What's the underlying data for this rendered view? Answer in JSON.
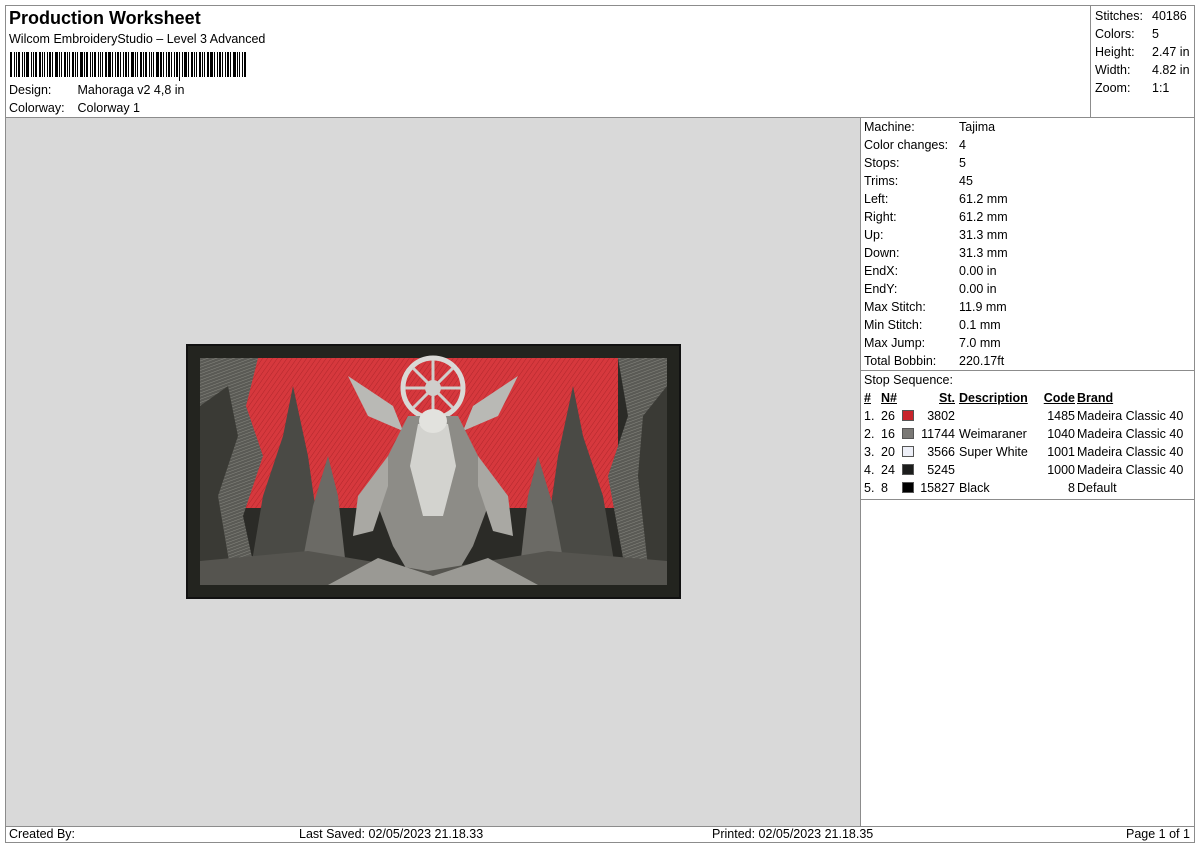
{
  "header": {
    "title": "Production Worksheet",
    "subtitle": "Wilcom EmbroideryStudio – Level 3 Advanced",
    "design_label": "Design:",
    "design_value": "Mahoraga v2 4,8 in",
    "colorway_label": "Colorway:",
    "colorway_value": "Colorway 1"
  },
  "stats": [
    {
      "label": "Stitches:",
      "value": "40186"
    },
    {
      "label": "Colors:",
      "value": "5"
    },
    {
      "label": "Height:",
      "value": "2.47 in"
    },
    {
      "label": "Width:",
      "value": "4.82 in"
    },
    {
      "label": "Zoom:",
      "value": "1:1"
    }
  ],
  "machine_info": [
    {
      "label": "Machine:",
      "value": "Tajima"
    },
    {
      "label": "Color changes:",
      "value": "4"
    },
    {
      "label": "Stops:",
      "value": "5"
    },
    {
      "label": "Trims:",
      "value": "45"
    },
    {
      "label": "Left:",
      "value": "61.2 mm"
    },
    {
      "label": "Right:",
      "value": "61.2 mm"
    },
    {
      "label": "Up:",
      "value": "31.3 mm"
    },
    {
      "label": "Down:",
      "value": "31.3 mm"
    },
    {
      "label": "EndX:",
      "value": "0.00 in"
    },
    {
      "label": "EndY:",
      "value": "0.00 in"
    },
    {
      "label": "Max Stitch:",
      "value": "11.9 mm"
    },
    {
      "label": "Min Stitch:",
      "value": "0.1 mm"
    },
    {
      "label": "Max Jump:",
      "value": "7.0 mm"
    },
    {
      "label": "Total Bobbin:",
      "value": "220.17ft"
    }
  ],
  "stop_sequence": {
    "heading": "Stop Sequence:",
    "columns": {
      "num": "#",
      "n": "N#",
      "st": "St.",
      "description": "Description",
      "code": "Code",
      "brand": "Brand"
    },
    "rows": [
      {
        "num": "1.",
        "n": "26",
        "color": "#c8242b",
        "st": "3802",
        "description": "",
        "code": "1485",
        "brand": "Madeira Classic 40"
      },
      {
        "num": "2.",
        "n": "16",
        "color": "#7a7875",
        "st": "11744",
        "description": "Weimaraner",
        "code": "1040",
        "brand": "Madeira Classic 40"
      },
      {
        "num": "3.",
        "n": "20",
        "color": "#eef0f8",
        "st": "3566",
        "description": "Super White",
        "code": "1001",
        "brand": "Madeira Classic 40"
      },
      {
        "num": "4.",
        "n": "24",
        "color": "#1c1d1c",
        "st": "5245",
        "description": "",
        "code": "1000",
        "brand": "Madeira Classic 40"
      },
      {
        "num": "5.",
        "n": "8",
        "color": "#000000",
        "st": "15827",
        "description": "Black",
        "code": "8",
        "brand": "Default"
      }
    ]
  },
  "footer": {
    "created_by": "Created By:",
    "last_saved": "Last Saved: 02/05/2023 21.18.33",
    "printed": "Printed: 02/05/2023 21.18.35",
    "page": "Page 1 of 1"
  }
}
